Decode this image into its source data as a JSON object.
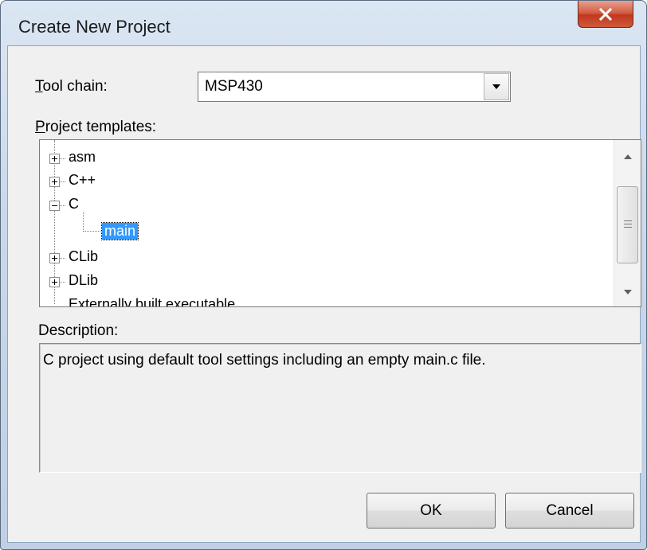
{
  "window": {
    "title": "Create New Project",
    "close_glyph": "close-icon"
  },
  "toolchain": {
    "label_key": "T",
    "label_rest": "ool chain:",
    "value": "MSP430"
  },
  "templates": {
    "label_key": "P",
    "label_rest": "roject templates:",
    "items": [
      {
        "label": "asm",
        "expander": "plus"
      },
      {
        "label": "C++",
        "expander": "plus"
      },
      {
        "label": "C",
        "expander": "minus"
      },
      {
        "label": "main",
        "expander": "none",
        "selected": true
      },
      {
        "label": "CLib",
        "expander": "plus"
      },
      {
        "label": "DLib",
        "expander": "plus"
      },
      {
        "label": "Externally built executable",
        "expander": "none"
      }
    ]
  },
  "description": {
    "label": "Description:",
    "text": "C project using default tool settings including an empty main.c file."
  },
  "buttons": {
    "ok": "OK",
    "cancel": "Cancel"
  }
}
